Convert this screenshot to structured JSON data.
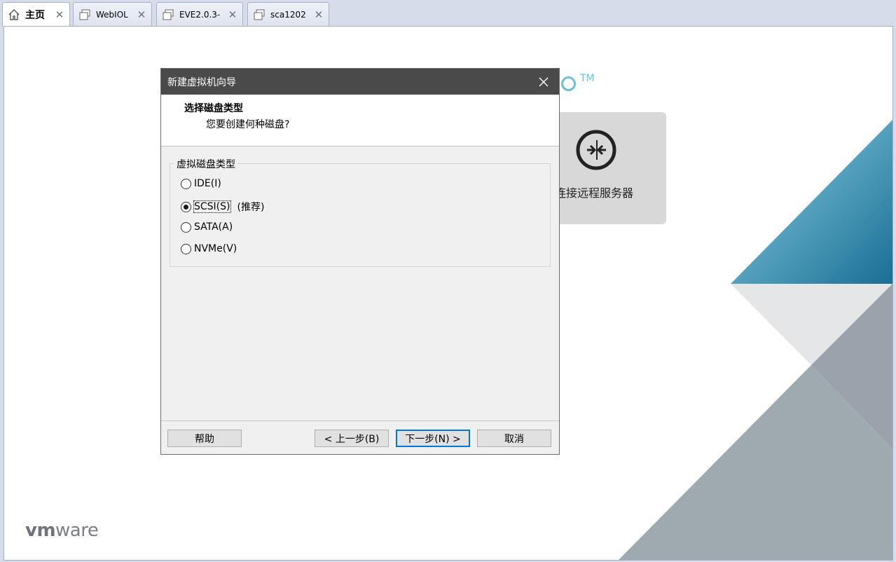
{
  "tabs": [
    {
      "label": "主页",
      "icon": "home-icon"
    },
    {
      "label": "WebIOL",
      "icon": "vm-icon"
    },
    {
      "label": "EVE2.0.3-",
      "icon": "vm-icon"
    },
    {
      "label": "sca1202",
      "icon": "vm-icon"
    }
  ],
  "tab_close_glyph": "✕",
  "home": {
    "tm": "TM",
    "remote_server_label": "连接远程服务器",
    "vmware_logo": {
      "bold": "vm",
      "rest": "ware"
    }
  },
  "dialog": {
    "title": "新建虚拟机向导",
    "header_title": "选择磁盘类型",
    "header_subtitle": "您要创建何种磁盘?",
    "group_label": "虚拟磁盘类型",
    "options": [
      {
        "label": "IDE(I)",
        "checked": false
      },
      {
        "label": "SCSI(S)",
        "checked": true,
        "note": "(推荐)"
      },
      {
        "label": "SATA(A)",
        "checked": false
      },
      {
        "label": "NVMe(V)",
        "checked": false
      }
    ],
    "buttons": {
      "help": "帮助",
      "back": "< 上一步(B)",
      "next": "下一步(N) >",
      "cancel": "取消"
    }
  },
  "colors": {
    "accent": "#0078d7",
    "titlebar": "#4a4a4a",
    "vmware_teal": "#6ac0d9",
    "vmware_blue": "#1a7fa6"
  }
}
